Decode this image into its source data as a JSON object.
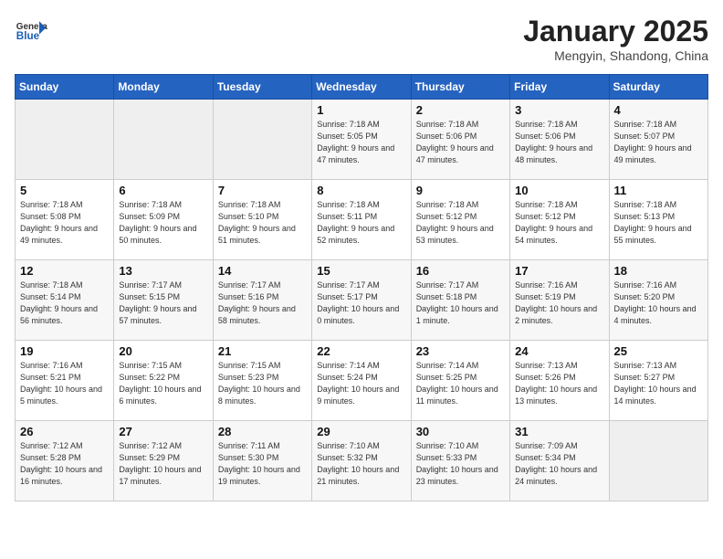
{
  "logo": {
    "general": "General",
    "blue": "Blue"
  },
  "title": "January 2025",
  "subtitle": "Mengyin, Shandong, China",
  "days_header": [
    "Sunday",
    "Monday",
    "Tuesday",
    "Wednesday",
    "Thursday",
    "Friday",
    "Saturday"
  ],
  "weeks": [
    [
      {
        "day": "",
        "empty": true
      },
      {
        "day": "",
        "empty": true
      },
      {
        "day": "",
        "empty": true
      },
      {
        "day": "1",
        "sunrise": "Sunrise: 7:18 AM",
        "sunset": "Sunset: 5:05 PM",
        "daylight": "Daylight: 9 hours and 47 minutes."
      },
      {
        "day": "2",
        "sunrise": "Sunrise: 7:18 AM",
        "sunset": "Sunset: 5:06 PM",
        "daylight": "Daylight: 9 hours and 47 minutes."
      },
      {
        "day": "3",
        "sunrise": "Sunrise: 7:18 AM",
        "sunset": "Sunset: 5:06 PM",
        "daylight": "Daylight: 9 hours and 48 minutes."
      },
      {
        "day": "4",
        "sunrise": "Sunrise: 7:18 AM",
        "sunset": "Sunset: 5:07 PM",
        "daylight": "Daylight: 9 hours and 49 minutes."
      }
    ],
    [
      {
        "day": "5",
        "sunrise": "Sunrise: 7:18 AM",
        "sunset": "Sunset: 5:08 PM",
        "daylight": "Daylight: 9 hours and 49 minutes."
      },
      {
        "day": "6",
        "sunrise": "Sunrise: 7:18 AM",
        "sunset": "Sunset: 5:09 PM",
        "daylight": "Daylight: 9 hours and 50 minutes."
      },
      {
        "day": "7",
        "sunrise": "Sunrise: 7:18 AM",
        "sunset": "Sunset: 5:10 PM",
        "daylight": "Daylight: 9 hours and 51 minutes."
      },
      {
        "day": "8",
        "sunrise": "Sunrise: 7:18 AM",
        "sunset": "Sunset: 5:11 PM",
        "daylight": "Daylight: 9 hours and 52 minutes."
      },
      {
        "day": "9",
        "sunrise": "Sunrise: 7:18 AM",
        "sunset": "Sunset: 5:12 PM",
        "daylight": "Daylight: 9 hours and 53 minutes."
      },
      {
        "day": "10",
        "sunrise": "Sunrise: 7:18 AM",
        "sunset": "Sunset: 5:12 PM",
        "daylight": "Daylight: 9 hours and 54 minutes."
      },
      {
        "day": "11",
        "sunrise": "Sunrise: 7:18 AM",
        "sunset": "Sunset: 5:13 PM",
        "daylight": "Daylight: 9 hours and 55 minutes."
      }
    ],
    [
      {
        "day": "12",
        "sunrise": "Sunrise: 7:18 AM",
        "sunset": "Sunset: 5:14 PM",
        "daylight": "Daylight: 9 hours and 56 minutes."
      },
      {
        "day": "13",
        "sunrise": "Sunrise: 7:17 AM",
        "sunset": "Sunset: 5:15 PM",
        "daylight": "Daylight: 9 hours and 57 minutes."
      },
      {
        "day": "14",
        "sunrise": "Sunrise: 7:17 AM",
        "sunset": "Sunset: 5:16 PM",
        "daylight": "Daylight: 9 hours and 58 minutes."
      },
      {
        "day": "15",
        "sunrise": "Sunrise: 7:17 AM",
        "sunset": "Sunset: 5:17 PM",
        "daylight": "Daylight: 10 hours and 0 minutes."
      },
      {
        "day": "16",
        "sunrise": "Sunrise: 7:17 AM",
        "sunset": "Sunset: 5:18 PM",
        "daylight": "Daylight: 10 hours and 1 minute."
      },
      {
        "day": "17",
        "sunrise": "Sunrise: 7:16 AM",
        "sunset": "Sunset: 5:19 PM",
        "daylight": "Daylight: 10 hours and 2 minutes."
      },
      {
        "day": "18",
        "sunrise": "Sunrise: 7:16 AM",
        "sunset": "Sunset: 5:20 PM",
        "daylight": "Daylight: 10 hours and 4 minutes."
      }
    ],
    [
      {
        "day": "19",
        "sunrise": "Sunrise: 7:16 AM",
        "sunset": "Sunset: 5:21 PM",
        "daylight": "Daylight: 10 hours and 5 minutes."
      },
      {
        "day": "20",
        "sunrise": "Sunrise: 7:15 AM",
        "sunset": "Sunset: 5:22 PM",
        "daylight": "Daylight: 10 hours and 6 minutes."
      },
      {
        "day": "21",
        "sunrise": "Sunrise: 7:15 AM",
        "sunset": "Sunset: 5:23 PM",
        "daylight": "Daylight: 10 hours and 8 minutes."
      },
      {
        "day": "22",
        "sunrise": "Sunrise: 7:14 AM",
        "sunset": "Sunset: 5:24 PM",
        "daylight": "Daylight: 10 hours and 9 minutes."
      },
      {
        "day": "23",
        "sunrise": "Sunrise: 7:14 AM",
        "sunset": "Sunset: 5:25 PM",
        "daylight": "Daylight: 10 hours and 11 minutes."
      },
      {
        "day": "24",
        "sunrise": "Sunrise: 7:13 AM",
        "sunset": "Sunset: 5:26 PM",
        "daylight": "Daylight: 10 hours and 13 minutes."
      },
      {
        "day": "25",
        "sunrise": "Sunrise: 7:13 AM",
        "sunset": "Sunset: 5:27 PM",
        "daylight": "Daylight: 10 hours and 14 minutes."
      }
    ],
    [
      {
        "day": "26",
        "sunrise": "Sunrise: 7:12 AM",
        "sunset": "Sunset: 5:28 PM",
        "daylight": "Daylight: 10 hours and 16 minutes."
      },
      {
        "day": "27",
        "sunrise": "Sunrise: 7:12 AM",
        "sunset": "Sunset: 5:29 PM",
        "daylight": "Daylight: 10 hours and 17 minutes."
      },
      {
        "day": "28",
        "sunrise": "Sunrise: 7:11 AM",
        "sunset": "Sunset: 5:30 PM",
        "daylight": "Daylight: 10 hours and 19 minutes."
      },
      {
        "day": "29",
        "sunrise": "Sunrise: 7:10 AM",
        "sunset": "Sunset: 5:32 PM",
        "daylight": "Daylight: 10 hours and 21 minutes."
      },
      {
        "day": "30",
        "sunrise": "Sunrise: 7:10 AM",
        "sunset": "Sunset: 5:33 PM",
        "daylight": "Daylight: 10 hours and 23 minutes."
      },
      {
        "day": "31",
        "sunrise": "Sunrise: 7:09 AM",
        "sunset": "Sunset: 5:34 PM",
        "daylight": "Daylight: 10 hours and 24 minutes."
      },
      {
        "day": "",
        "empty": true
      }
    ]
  ]
}
